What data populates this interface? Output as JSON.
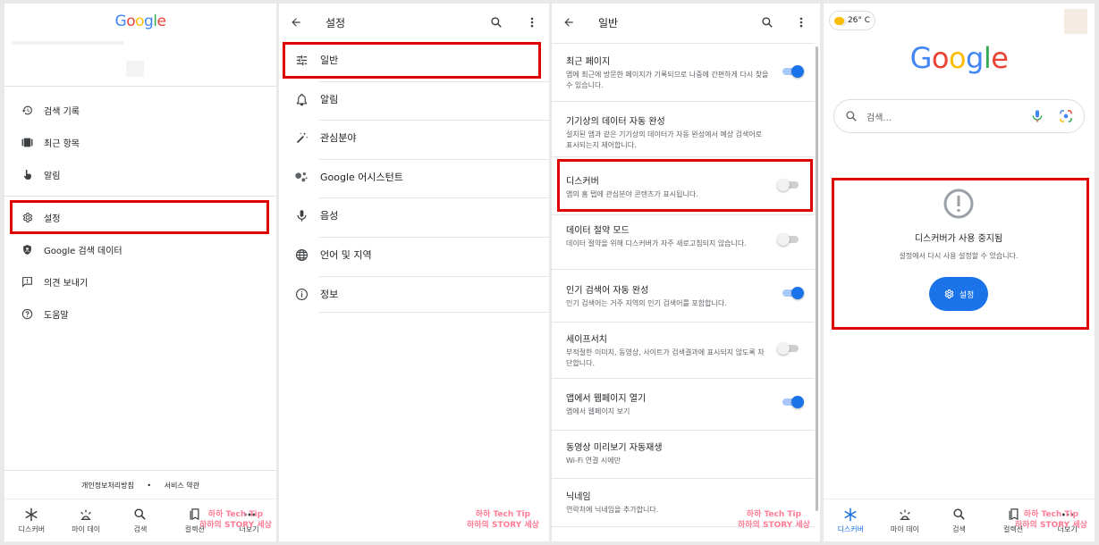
{
  "panel1": {
    "logo": "Google",
    "drawer_items": [
      {
        "label": "검색 기록",
        "icon": "history-icon"
      },
      {
        "label": "최근 항목",
        "icon": "recent-items-icon"
      },
      {
        "label": "알림",
        "icon": "notifications-icon"
      },
      {
        "label": "설정",
        "icon": "gear-icon"
      },
      {
        "label": "Google 검색 데이터",
        "icon": "shield-icon"
      },
      {
        "label": "의견 보내기",
        "icon": "feedback-icon"
      },
      {
        "label": "도움말",
        "icon": "help-icon"
      }
    ],
    "footer": {
      "privacy": "개인정보처리방침",
      "dot": "•",
      "terms": "서비스 약관"
    },
    "nav": [
      {
        "label": "디스커버",
        "icon": "asterisk-icon"
      },
      {
        "label": "마이 데이",
        "icon": "sunrise-icon"
      },
      {
        "label": "검색",
        "icon": "search-icon"
      },
      {
        "label": "컬렉션",
        "icon": "bookmark-icon"
      },
      {
        "label": "더보기",
        "icon": "more-horiz-icon"
      }
    ]
  },
  "panel2": {
    "title": "설정",
    "items": [
      {
        "label": "일반",
        "icon": "tune-icon"
      },
      {
        "label": "알림",
        "icon": "bell-icon"
      },
      {
        "label": "관심분야",
        "icon": "magic-wand-icon"
      },
      {
        "label": "Google 어시스턴트",
        "icon": "assistant-icon"
      },
      {
        "label": "음성",
        "icon": "mic-icon"
      },
      {
        "label": "언어 및 지역",
        "icon": "globe-icon"
      },
      {
        "label": "정보",
        "icon": "info-icon"
      }
    ]
  },
  "panel3": {
    "title": "일반",
    "items": [
      {
        "title": "최근 페이지",
        "sub": "앱에 최근에 방문한 페이지가 기록되므로 나중에 간편하게 다시 찾을 수 있습니다.",
        "toggle": true
      },
      {
        "title": "기기상의 데이터 자동 완성",
        "sub": "설치된 앱과 같은 기기상의 데이터가 자동 완성에서 예상 검색어로 표시되는지 제어합니다.",
        "toggle": null
      },
      {
        "title": "디스커버",
        "sub": "앱의 홈 탭에 관심분야 콘텐츠가 표시됩니다.",
        "toggle": false
      },
      {
        "title": "데이터 절약 모드",
        "sub": "데이터 절약을 위해 디스커버가 자주 새로고침되지 않습니다.",
        "toggle": false
      },
      {
        "title": "인기 검색어 자동 완성",
        "sub": "인기 검색어는 거주 지역의 인기 검색어를 포함합니다.",
        "toggle": true
      },
      {
        "title": "세이프서치",
        "sub": "부적절한 이미지, 동영상, 사이트가 검색결과에 표시되지 않도록 차단합니다.",
        "toggle": false
      },
      {
        "title": "앱에서 웹페이지 열기",
        "sub": "앱에서 웹페이지 보기",
        "toggle": true
      },
      {
        "title": "동영상 미리보기 자동재생",
        "sub": "Wi-Fi 연결 시에만",
        "toggle": null
      },
      {
        "title": "닉네임",
        "sub": "연락처에 닉네임을 추가합니다.",
        "toggle": null
      }
    ]
  },
  "panel4": {
    "weather": "26° C",
    "logo": "Google",
    "search_placeholder": "검색...",
    "disabled_title": "디스커버가 사용 중지됨",
    "disabled_sub": "설정에서 다시 사용 설정할 수 있습니다.",
    "settings_button": "설정",
    "nav": [
      {
        "label": "디스커버",
        "icon": "asterisk-icon"
      },
      {
        "label": "마이 데이",
        "icon": "sunrise-icon"
      },
      {
        "label": "검색",
        "icon": "search-icon"
      },
      {
        "label": "컬렉션",
        "icon": "bookmark-icon"
      },
      {
        "label": "더보기",
        "icon": "more-horiz-icon"
      }
    ]
  },
  "watermark": {
    "line1": "하하 Tech Tip",
    "line2": "하하의 STORY 세상"
  },
  "colors": {
    "accent": "#1a73e8",
    "highlight": "#e00000"
  }
}
